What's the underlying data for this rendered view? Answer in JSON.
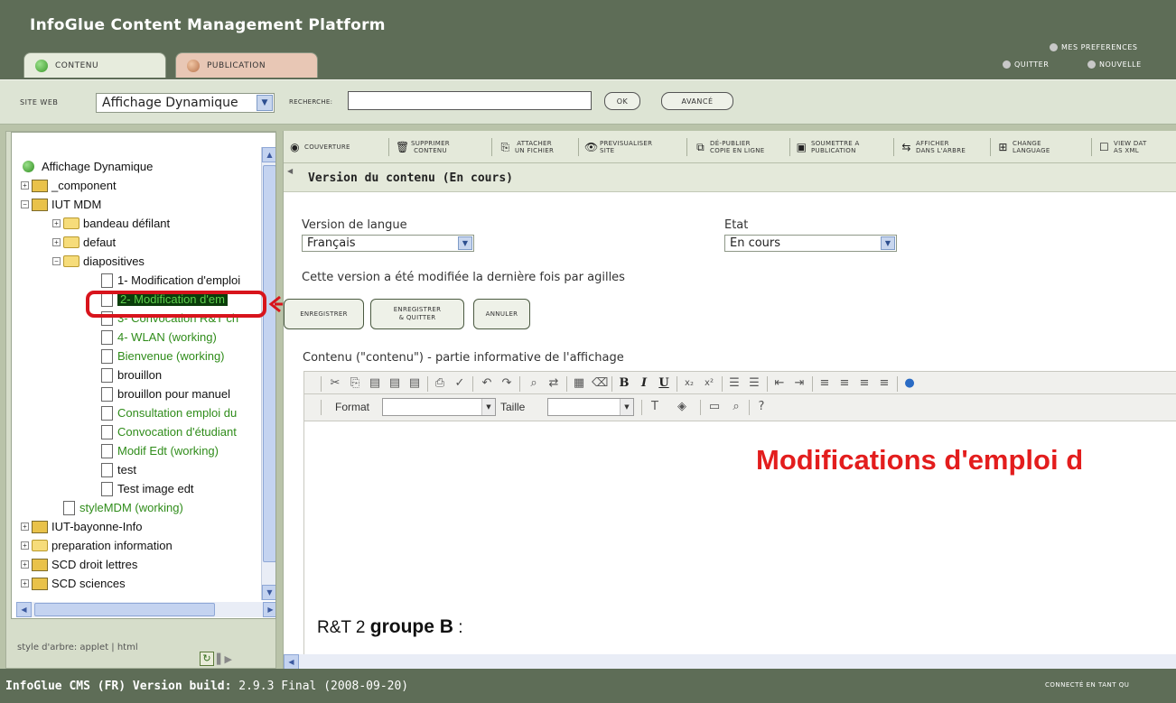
{
  "header": {
    "app_title": "InfoGlue Content Management Platform",
    "tabs": [
      "CONTENU",
      "PUBLICATION"
    ],
    "links": {
      "preferences": "MES PREFERENCES",
      "quit": "QUITTER",
      "new": "NOUVELLE"
    }
  },
  "searchbar": {
    "site_label": "SITE WEB",
    "site_value": "Affichage Dynamique",
    "search_label": "RECHERCHE:",
    "search_value": "",
    "ok_label": "OK",
    "advanced_label": "AVANCÉ"
  },
  "tree": {
    "root": "Affichage Dynamique",
    "items": [
      {
        "label": "_component"
      },
      {
        "label": "IUT MDM"
      },
      {
        "label": "bandeau défilant"
      },
      {
        "label": "defaut"
      },
      {
        "label": "diapositives"
      },
      {
        "label": "1- Modification d'emploi"
      },
      {
        "label": "2- Modification d'em"
      },
      {
        "label": "3- Convocation R&T ch"
      },
      {
        "label": "4- WLAN (working)"
      },
      {
        "label": "Bienvenue (working)"
      },
      {
        "label": "brouillon"
      },
      {
        "label": "brouillon pour manuel"
      },
      {
        "label": "Consultation emploi du"
      },
      {
        "label": "Convocation d'étudiant"
      },
      {
        "label": "Modif Edt (working)"
      },
      {
        "label": "test"
      },
      {
        "label": "Test image edt"
      },
      {
        "label": "styleMDM (working)"
      },
      {
        "label": "IUT-bayonne-Info"
      },
      {
        "label": "preparation information"
      },
      {
        "label": "SCD droit lettres"
      },
      {
        "label": "SCD sciences"
      }
    ],
    "style_label": "style d'arbre: applet | html"
  },
  "toolbar": {
    "couverture": "COUVERTURE",
    "supprimer": [
      "SUPPRIMER",
      "CONTENU"
    ],
    "attacher": [
      "ATTACHER",
      "UN FICHIER"
    ],
    "previsualiser": [
      "PREVISUALISER",
      "SITE"
    ],
    "depublier": [
      "DÉ-PUBLIER",
      "COPIE EN LIGNE"
    ],
    "soumettre": [
      "SOUMETTRE A",
      "PUBLICATION"
    ],
    "afficher": [
      "AFFICHER",
      "DANS L'ARBRE"
    ],
    "change_langue": [
      "CHANGE",
      "LANGUAGE"
    ],
    "view_xml": [
      "VIEW DAT",
      "AS XML"
    ]
  },
  "version": {
    "title": "Version du contenu (En cours)",
    "lang_label": "Version de langue",
    "lang_value": "Français",
    "etat_label": "Etat",
    "etat_value": "En cours",
    "modified_by": "Cette version a été modifiée la dernière fois par agilles",
    "btn_save": "ENREGISTRER",
    "btn_save_quit": [
      "ENREGISTRER",
      "& QUITTER"
    ],
    "btn_cancel": "ANNULER",
    "content_label": "Contenu (\"contenu\") - partie informative de l'affichage"
  },
  "editor": {
    "format_label": "Format",
    "taille_label": "Taille",
    "heading": "Modifications d'emploi d",
    "group_prefix": "R&T 2 ",
    "group_bold": "groupe B",
    "group_suffix": " :"
  },
  "status": {
    "left_bold": "InfoGlue CMS (FR) Version build:",
    "left_version": " 2.9.3 Final (2008-09-20)",
    "right": "CONNECTÉ EN TANT QU"
  },
  "colors": {
    "header": "#5e6d57",
    "heading_red": "#e31d1d",
    "selected_bg": "#0a3d0a",
    "tree_green": "#2f8c1a"
  }
}
